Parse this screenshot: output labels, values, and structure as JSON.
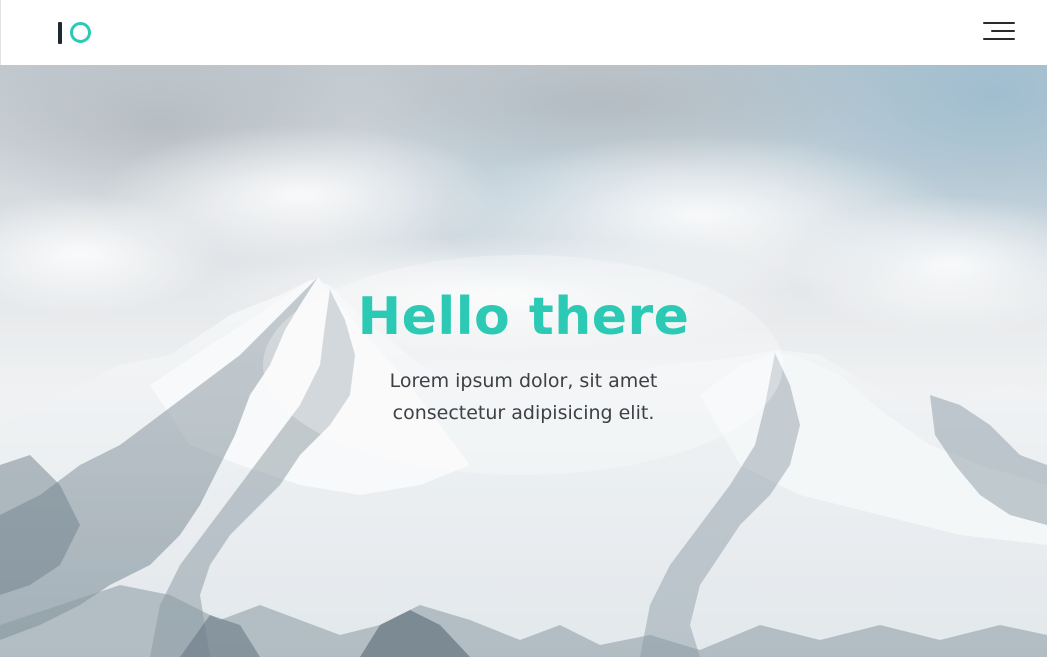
{
  "header": {
    "logo_icon": "io-logo-icon",
    "menu_icon": "hamburger-menu-icon"
  },
  "hero": {
    "title": "Hello there",
    "subtitle_line1": "Lorem ipsum dolor, sit amet",
    "subtitle_line2": "consectetur adipisicing elit.",
    "background": "snowy-mountain-photo"
  },
  "colors": {
    "accent": "#2cc9b5",
    "logo_dark": "#1b2a33",
    "text": "#3d4146",
    "header_bg": "#ffffff"
  }
}
